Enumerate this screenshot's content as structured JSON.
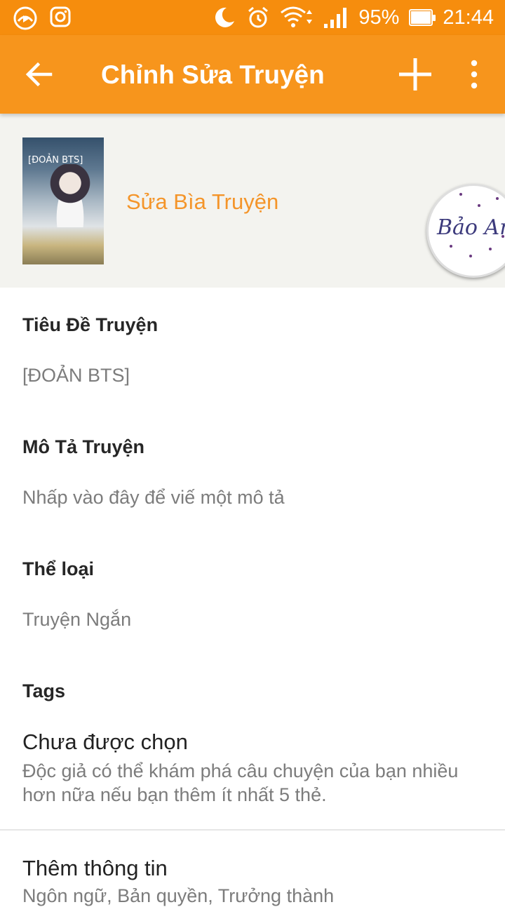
{
  "status_bar": {
    "left_icons": [
      "music-app-icon",
      "instagram-icon"
    ],
    "right_icons": [
      "moon-icon",
      "alarm-icon",
      "wifi-icon",
      "signal-icon",
      "battery-icon"
    ],
    "battery_percent": "95%",
    "time": "21:44"
  },
  "app_bar": {
    "title": "Chỉnh Sửa Truyện",
    "back_icon": "arrow-left-icon",
    "add_icon": "plus-icon",
    "more_icon": "more-vertical-icon",
    "background_color": "#f7951c"
  },
  "cover": {
    "cover_text": "[ĐOẢN BTS]",
    "edit_label": "Sửa Bìa Truyện",
    "badge_text": "Bảo Anh"
  },
  "form": {
    "title_label": "Tiêu Đề Truyện",
    "title_value": "[ĐOẢN BTS]",
    "description_label": "Mô Tả Truyện",
    "description_placeholder": "Nhấp vào đây để viế một mô tả",
    "genre_label": "Thể loại",
    "genre_value": "Truyện Ngắn",
    "tags_label": "Tags",
    "tags_status": "Chưa được chọn",
    "tags_hint": "Độc giả có thể khám phá câu chuyện của bạn nhiều hơn nữa nếu bạn thêm ít nhất 5 thẻ.",
    "more_info_title": "Thêm thông tin",
    "more_info_desc": "Ngôn ngữ, Bản quyền, Trưởng thành"
  },
  "colors": {
    "accent": "#f4952a",
    "status_bar": "#f68d0d"
  }
}
